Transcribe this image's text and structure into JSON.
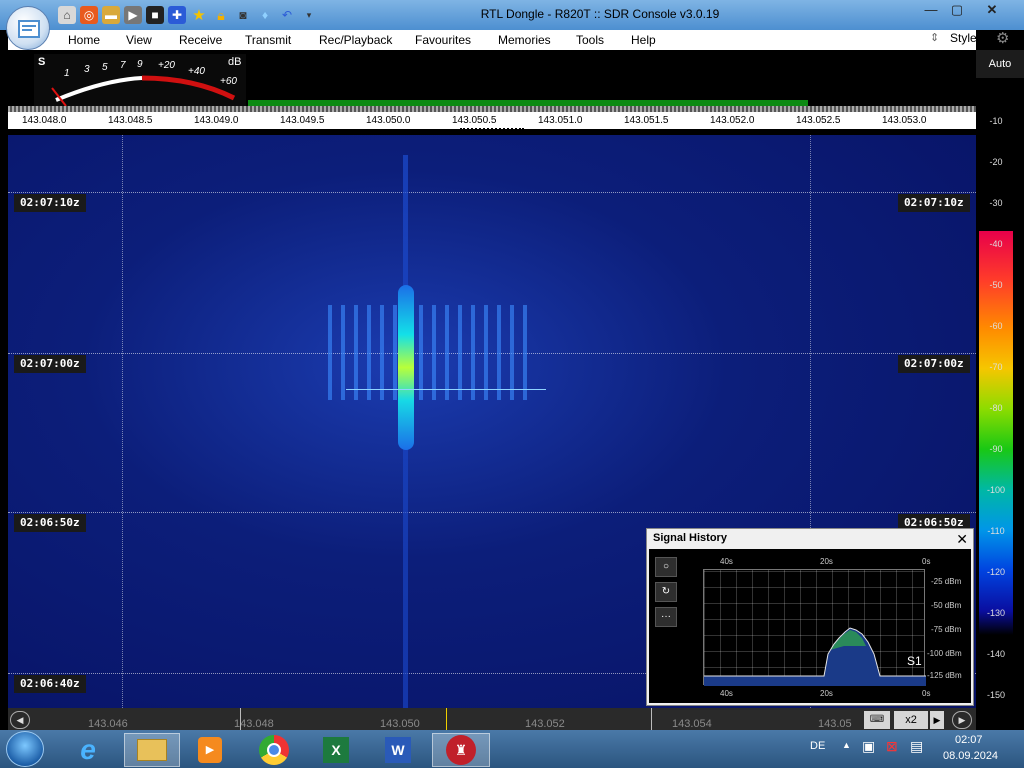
{
  "window": {
    "title": "RTL Dongle - R820T :: SDR Console v3.0.19"
  },
  "menu": [
    "Home",
    "View",
    "Receive",
    "Transmit",
    "Rec/Playback",
    "Favourites",
    "Memories",
    "Tools",
    "Help"
  ],
  "style_label": "Style",
  "smeter": {
    "s_label": "S",
    "scale": [
      "1",
      "3",
      "5",
      "7",
      "9",
      "+20",
      "+40",
      "+60"
    ],
    "db_label": "dB"
  },
  "freq_ticks": [
    "143.048.0",
    "143.048.5",
    "143.049.0",
    "143.049.5",
    "143.050.0",
    "143.050.5",
    "143.051.0",
    "143.051.5",
    "143.052.0",
    "143.052.5",
    "143.053.0"
  ],
  "time_labels": [
    "02:07:10z",
    "02:07:00z",
    "02:06:50z",
    "02:06:40z"
  ],
  "scale": {
    "auto": "Auto",
    "ticks": [
      "-10",
      "-20",
      "-30",
      "-40",
      "-50",
      "-60",
      "-70",
      "-80",
      "-90",
      "-100",
      "-110",
      "-120",
      "-130",
      "-140",
      "-150"
    ]
  },
  "bottom_ticks": [
    "143.046",
    "143.048",
    "143.050",
    "143.052",
    "143.054",
    "143.05"
  ],
  "zoom": "x2",
  "signal_history": {
    "title": "Signal History",
    "top_ticks": [
      "40s",
      "20s",
      "0s"
    ],
    "bottom_ticks": [
      "40s",
      "20s",
      "0s"
    ],
    "y_labels": [
      "-25 dBm",
      "-50 dBm",
      "-75 dBm",
      "-100 dBm",
      "-125 dBm"
    ],
    "s_value": "S1"
  },
  "tray": {
    "lang": "DE",
    "time": "02:07",
    "date": "08.09.2024"
  },
  "colors": {
    "accent": "#4d8fd0",
    "waterfall": "#0c1e7a"
  }
}
